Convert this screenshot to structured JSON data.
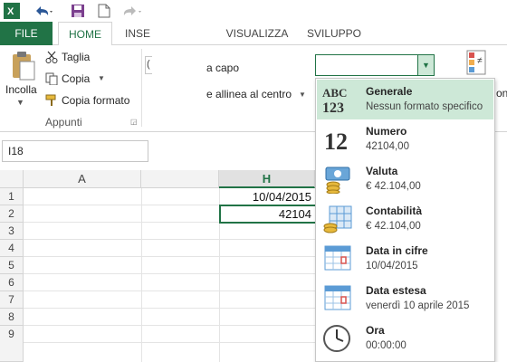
{
  "qat": {
    "icons": [
      "excel-logo-icon",
      "undo-icon",
      "save-icon",
      "new-file-icon",
      "redo-icon"
    ]
  },
  "tabs": {
    "file": "FILE",
    "home": "HOME",
    "insert_partial": "INSE",
    "view": "VISUALIZZA",
    "developer": "SVILUPPO"
  },
  "ribbon": {
    "paste_label": "Incolla",
    "cut_label": "Taglia",
    "copy_label": "Copia",
    "format_painter_label": "Copia formato",
    "clipboard_group": "Appunti",
    "wrap_text_partial": "a capo",
    "merge_center_partial": "e allinea al centro",
    "conditional_partial": "on",
    "font_partial": "("
  },
  "formula_bar": {
    "name_box": "I18"
  },
  "grid": {
    "col_a": "A",
    "col_h": "H",
    "rows": [
      "1",
      "2",
      "3",
      "4",
      "5",
      "6",
      "7",
      "8",
      "9"
    ],
    "h1": "10/04/2015",
    "h2": "42104"
  },
  "number_format_menu": {
    "items": [
      {
        "title": "Generale",
        "sample": "Nessun formato specifico",
        "icon": "general-format-icon"
      },
      {
        "title": "Numero",
        "sample": "42104,00",
        "icon": "number-format-icon"
      },
      {
        "title": "Valuta",
        "sample": "€ 42.104,00",
        "icon": "currency-format-icon"
      },
      {
        "title": "Contabilità",
        "sample": " € 42.104,00",
        "icon": "accounting-format-icon"
      },
      {
        "title": "Data in cifre",
        "sample": "10/04/2015",
        "icon": "short-date-icon"
      },
      {
        "title": "Data estesa",
        "sample": "venerdì 10 aprile 2015",
        "icon": "long-date-icon"
      },
      {
        "title": "Ora",
        "sample": "00:00:00",
        "icon": "time-format-icon"
      }
    ]
  },
  "colors": {
    "excel_green": "#217346",
    "selected_item_bg": "#cde8d7"
  }
}
